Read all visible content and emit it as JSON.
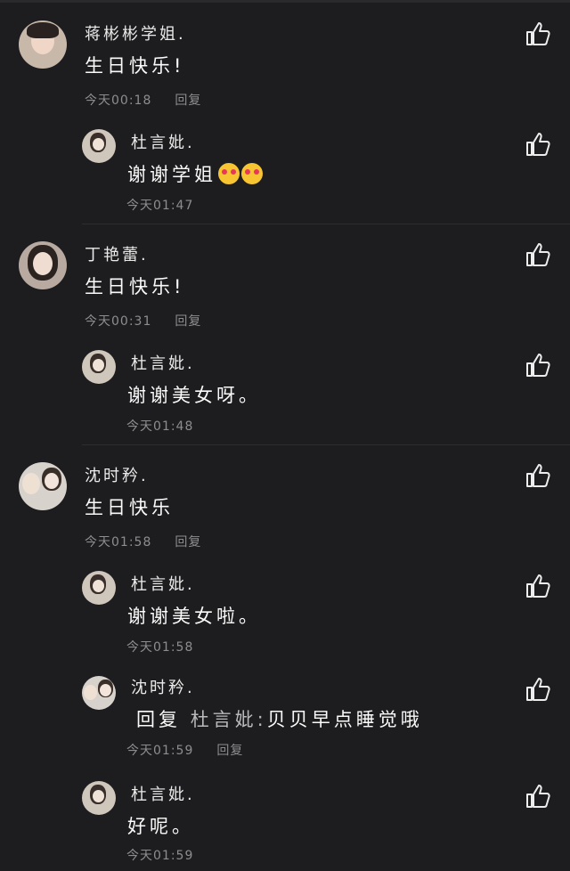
{
  "comments": [
    {
      "name": "蒋彬彬学姐.",
      "text": "生日快乐!",
      "time": "今天00:18",
      "reply_label": "回复",
      "replies": [
        {
          "name": "杜言妣.",
          "text": "谢谢学姐",
          "emoji_count": 2,
          "time": "今天01:47"
        }
      ]
    },
    {
      "name": "丁艳蕾.",
      "text": "生日快乐!",
      "time": "今天00:31",
      "reply_label": "回复",
      "replies": [
        {
          "name": "杜言妣.",
          "text": "谢谢美女呀。",
          "time": "今天01:48"
        }
      ]
    },
    {
      "name": "沈时矜.",
      "text": "生日快乐",
      "time": "今天01:58",
      "reply_label": "回复",
      "replies": [
        {
          "name": "杜言妣.",
          "text": "谢谢美女啦。",
          "time": "今天01:58"
        },
        {
          "name": "沈时矜.",
          "reply_prefix": "回复",
          "mention": "杜言妣:",
          "text": "贝贝早点睡觉哦",
          "time": "今天01:59",
          "reply_label": "回复"
        },
        {
          "name": "杜言妣.",
          "text": "好呢。",
          "time": "今天01:59"
        }
      ]
    }
  ],
  "icons": {
    "like": "thumbs-up-icon"
  },
  "colors": {
    "background": "#1d1d1f",
    "text": "#fafafa",
    "meta": "#8d8d90"
  }
}
